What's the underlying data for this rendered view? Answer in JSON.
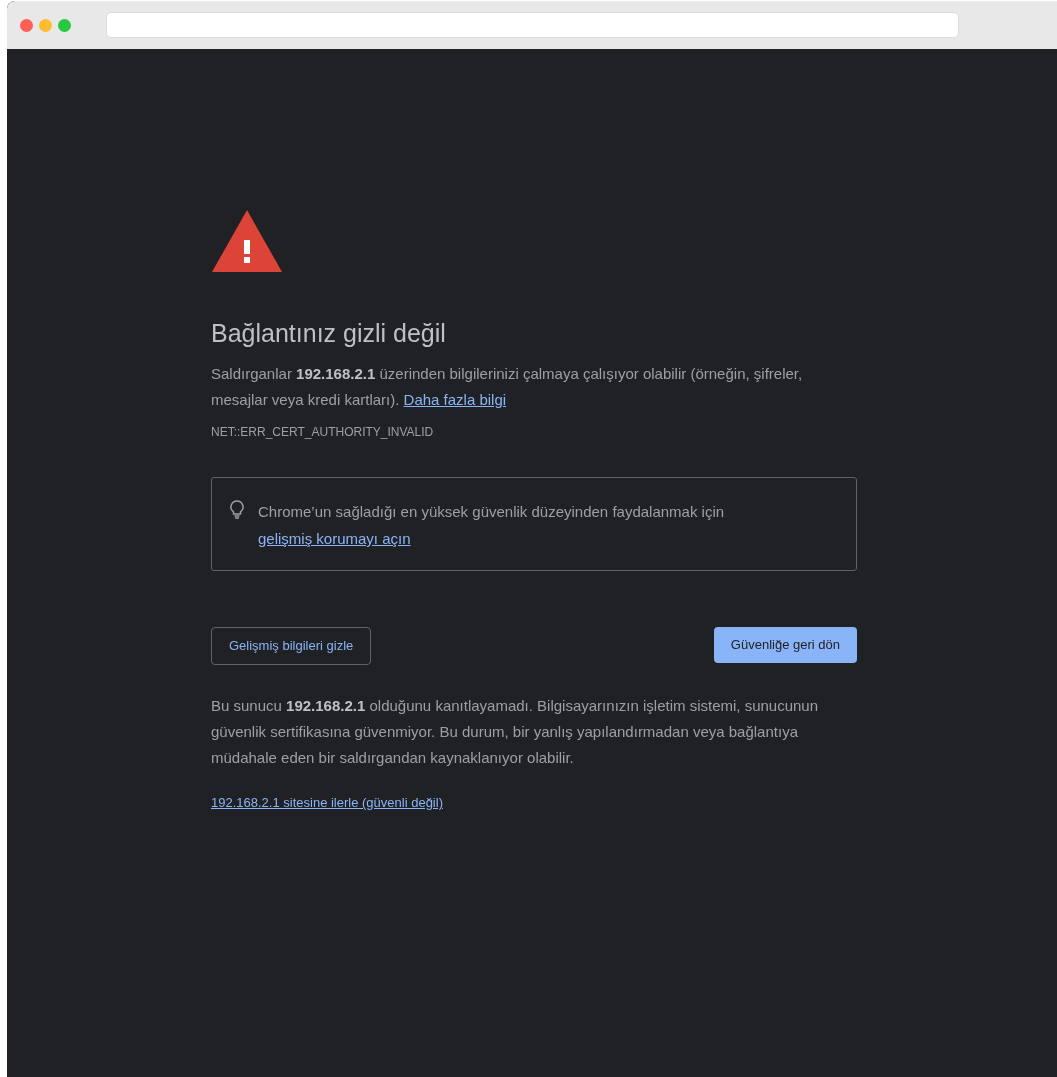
{
  "heading": "Bağlantınız gizli değil",
  "intro": {
    "text": "Saldırganlar **192.168.2.1** üzerinden bilgilerinizi çalmaya çalışıyor olabilir (örneğin, şifreler, mesajlar veya kredi kartları).",
    "link": "Daha fazla bilgi"
  },
  "error_code": "NET::ERR_CERT_AUTHORITY_INVALID",
  "tip": {
    "text": "Chrome’un sağladığı en yüksek güvenlik düzeyinden faydalanmak için",
    "link": "gelişmiş korumayı açın"
  },
  "buttons": [
    {
      "kind": "outline",
      "label": "Gelişmiş bilgileri gizle"
    },
    {
      "kind": "primary",
      "label": "Güvenliğe geri dön"
    }
  ],
  "details": "Bu sunucu **192.168.2.1** olduğunu kanıtlayamadı. Bilgisayarınızın işletim sistemi, sunucunun güvenlik sertifikasına güvenmiyor. Bu durum, bir yanlış yapılandırmadan veya bağlantıya müdahale eden bir saldırgandan kaynaklanıyor olabilir.",
  "proceed_link": "192.168.2.1 sitesine ilerle (güvenli değil)"
}
